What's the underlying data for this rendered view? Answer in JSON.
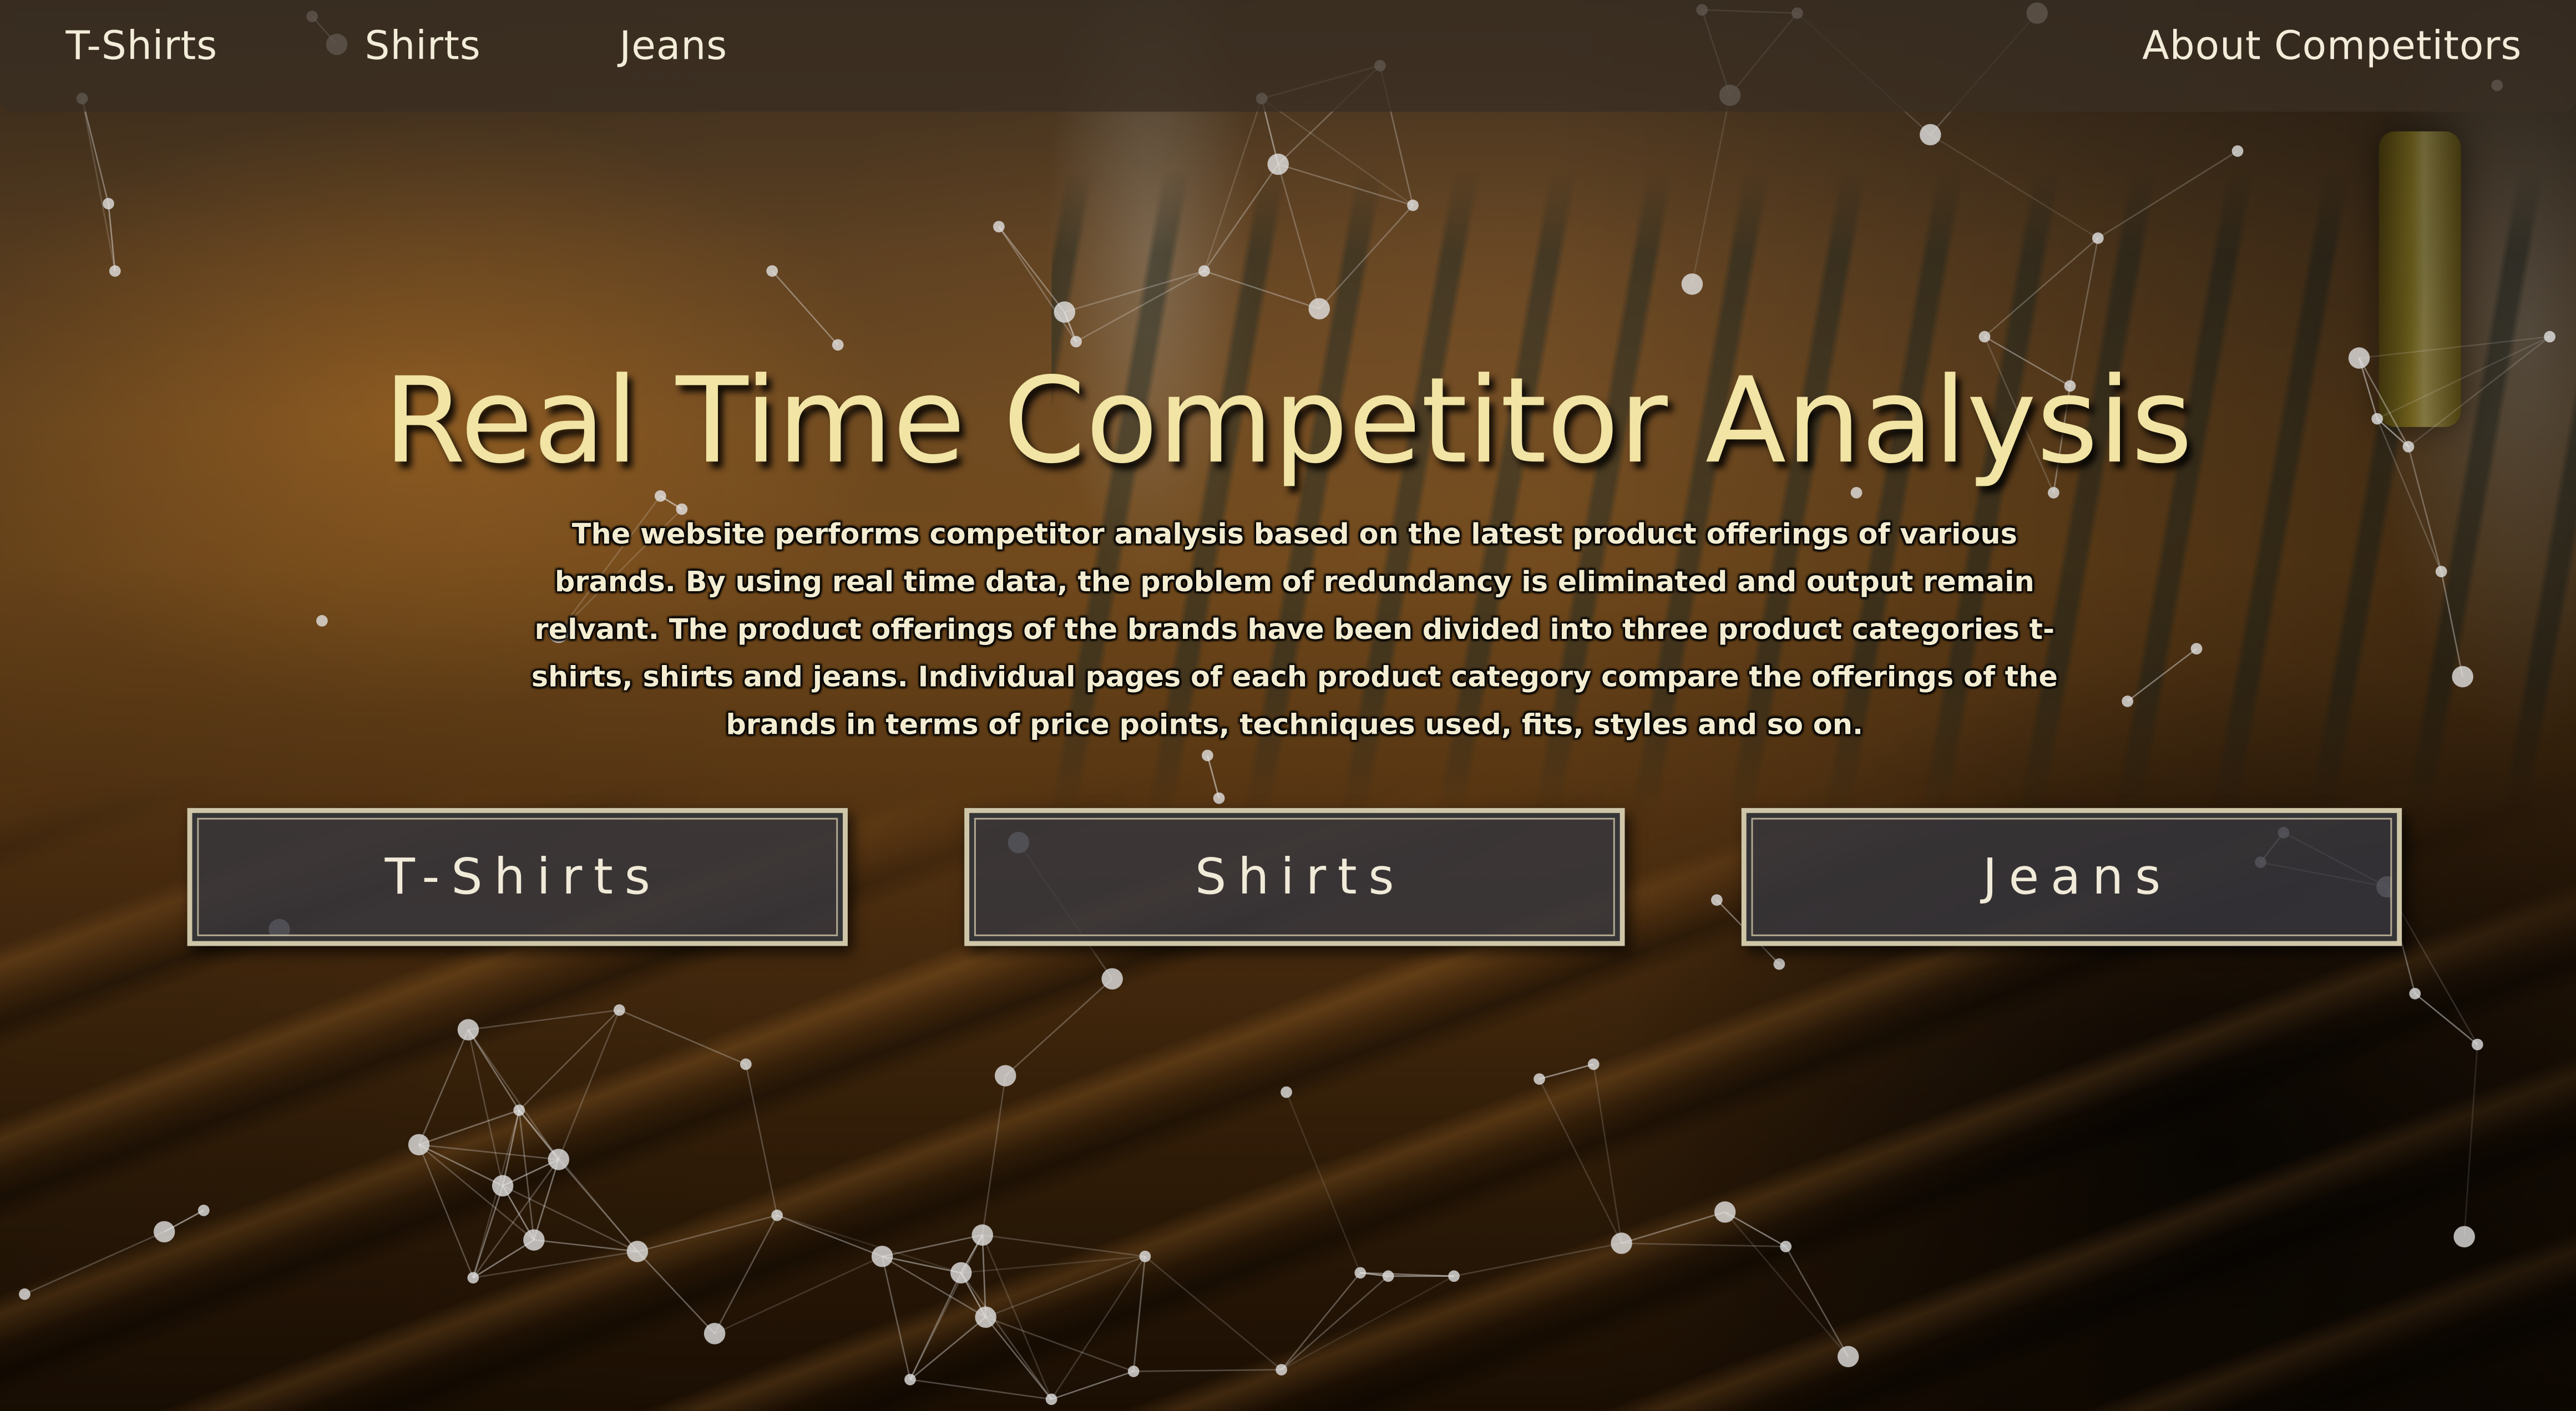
{
  "navbar": {
    "links": [
      {
        "label": "T-Shirts"
      },
      {
        "label": "Shirts"
      },
      {
        "label": "Jeans"
      }
    ],
    "about_label": "About Competitors"
  },
  "hero": {
    "title": "Real Time Competitor Analysis",
    "description": "The website performs competitor analysis based on the latest product offerings of various brands. By using real time data, the problem of redundancy is eliminated and output remain relvant. The product offerings of the brands have been divided into three product categories t-shirts, shirts and jeans. Individual pages of each product category compare the offerings of the brands in terms of price points, techniques used, fits, styles and so on."
  },
  "categories": [
    {
      "label": "T-Shirts"
    },
    {
      "label": "Shirts"
    },
    {
      "label": "Jeans"
    }
  ],
  "colors": {
    "title": "#f1e4a4",
    "button_border": "#cfc6a8",
    "navbar_bg": "#3a2e22"
  },
  "background": {
    "icon": "clothing-rack-photo",
    "overlay": "particle-network"
  }
}
